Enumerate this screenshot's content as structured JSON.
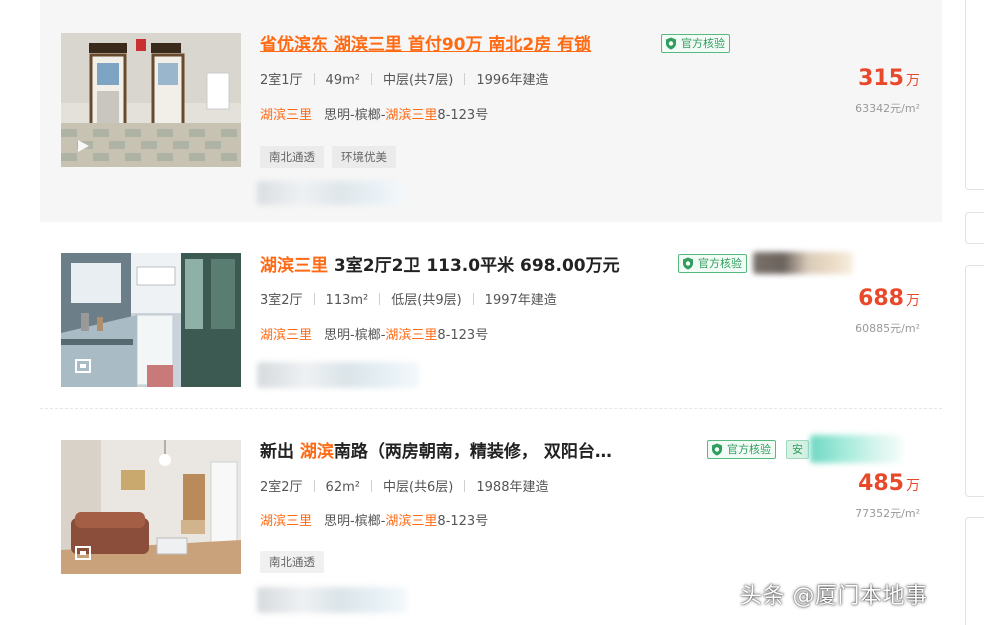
{
  "listings": [
    {
      "title_text": "省优滨东 湖滨三里 首付90万 南北2房 有锁",
      "verify_label": "官方核验",
      "meta": [
        "2室1厅",
        "49m²",
        "中层(共7层)",
        "1996年建造"
      ],
      "community": "湖滨三里",
      "district": "思明-槟榔-",
      "street_name": "湖滨三里",
      "street_no": "8-123号",
      "tags": [
        "南北通透",
        "环境优美"
      ],
      "price": "315",
      "price_unit": "万",
      "unit_price": "63342元/m²",
      "media_icon": "play-icon"
    },
    {
      "title_hl": "湖滨三里",
      "title_rest": " 3室2厅2卫 113.0平米 698.00万元",
      "verify_label": "官方核验",
      "meta": [
        "3室2厅",
        "113m²",
        "低层(共9层)",
        "1997年建造"
      ],
      "community": "湖滨三里",
      "district": "思明-槟榔-",
      "street_name": "湖滨三里",
      "street_no": "8-123号",
      "tags": [],
      "price": "688",
      "price_unit": "万",
      "unit_price": "60885元/m²",
      "media_icon": "panorama-icon"
    },
    {
      "title_pre": "新出 ",
      "title_hl": "湖滨",
      "title_rest": "南路（两房朝南，精装修， 双阳台…",
      "verify_label": "官方核验",
      "extra_badge": "安",
      "meta": [
        "2室2厅",
        "62m²",
        "中层(共6层)",
        "1988年建造"
      ],
      "community": "湖滨三里",
      "district": "思明-槟榔-",
      "street_name": "湖滨三里",
      "street_no": "8-123号",
      "tags": [
        "南北通透"
      ],
      "price": "485",
      "price_unit": "万",
      "unit_price": "77352元/m²",
      "media_icon": "panorama-icon"
    }
  ],
  "colors": {
    "accent": "#ff6a13",
    "price": "#e8492b",
    "verify_green": "#2f9e5e"
  },
  "watermark": "头条 @厦门本地事"
}
